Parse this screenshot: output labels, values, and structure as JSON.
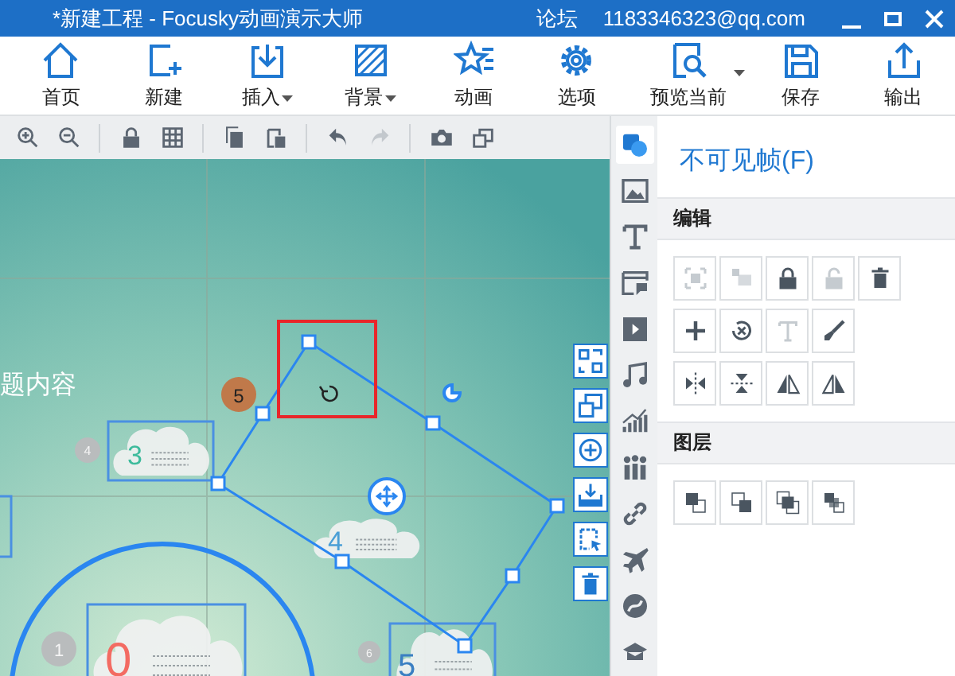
{
  "window": {
    "title": "*新建工程 - Focusky动画演示大师",
    "links": [
      "论坛",
      "1183346323@qq.com"
    ]
  },
  "toolbar": [
    {
      "label": "首页",
      "menu_caret": false,
      "split_caret": false
    },
    {
      "label": "新建",
      "menu_caret": false,
      "split_caret": false
    },
    {
      "label": "插入",
      "menu_caret": true,
      "split_caret": false
    },
    {
      "label": "背景",
      "menu_caret": true,
      "split_caret": false
    },
    {
      "label": "动画",
      "menu_caret": false,
      "split_caret": false
    },
    {
      "label": "选项",
      "menu_caret": false,
      "split_caret": false
    },
    {
      "label": "预览当前",
      "menu_caret": false,
      "split_caret": true
    },
    {
      "label": "保存",
      "menu_caret": false,
      "split_caret": false
    },
    {
      "label": "输出",
      "menu_caret": false,
      "split_caret": false
    }
  ],
  "edit_toolbar": [
    {
      "disabled": false
    },
    {
      "disabled": false
    },
    {
      "disabled": false
    },
    {
      "disabled": false
    },
    {
      "disabled": false
    },
    {
      "disabled": false
    },
    {
      "disabled": false
    },
    {
      "disabled": true
    },
    {
      "disabled": false
    },
    {
      "disabled": false
    }
  ],
  "canvas": {
    "title_fragment": "题内容",
    "order_badge": "5",
    "frames": [
      {
        "number": "3",
        "color": "#3dbb9c",
        "outlined": true
      },
      {
        "number": "4",
        "color": "#4a9fd6",
        "outlined": false
      },
      {
        "number": "0",
        "color": "#f36b62",
        "outlined": true
      },
      {
        "number": "5",
        "color": "#3a7fc2",
        "outlined": true
      }
    ],
    "markers": [
      "4",
      "1",
      "6"
    ]
  },
  "side_tabs": [
    {
      "selected": true
    },
    {
      "selected": false
    },
    {
      "selected": false
    },
    {
      "selected": false
    },
    {
      "selected": false
    },
    {
      "selected": false
    },
    {
      "selected": false
    },
    {
      "selected": false
    },
    {
      "selected": false
    },
    {
      "selected": false
    },
    {
      "selected": false
    },
    {
      "selected": false
    }
  ],
  "panel": {
    "title": "不可见帧(F)",
    "sections": [
      {
        "heading": "编辑",
        "rows": [
          [
            {
              "disabled": true
            },
            {
              "disabled": true
            },
            {
              "disabled": false
            },
            {
              "disabled": true
            },
            {
              "disabled": false
            }
          ],
          [
            {
              "disabled": false
            },
            {
              "disabled": false
            },
            {
              "disabled": true
            },
            {
              "disabled": false
            }
          ],
          [
            {
              "disabled": false
            },
            {
              "disabled": false
            },
            {
              "disabled": false
            },
            {
              "disabled": false
            }
          ]
        ]
      },
      {
        "heading": "图层",
        "rows": [
          [
            {
              "disabled": false
            },
            {
              "disabled": false
            },
            {
              "disabled": false
            },
            {
              "disabled": false
            }
          ]
        ]
      }
    ]
  }
}
